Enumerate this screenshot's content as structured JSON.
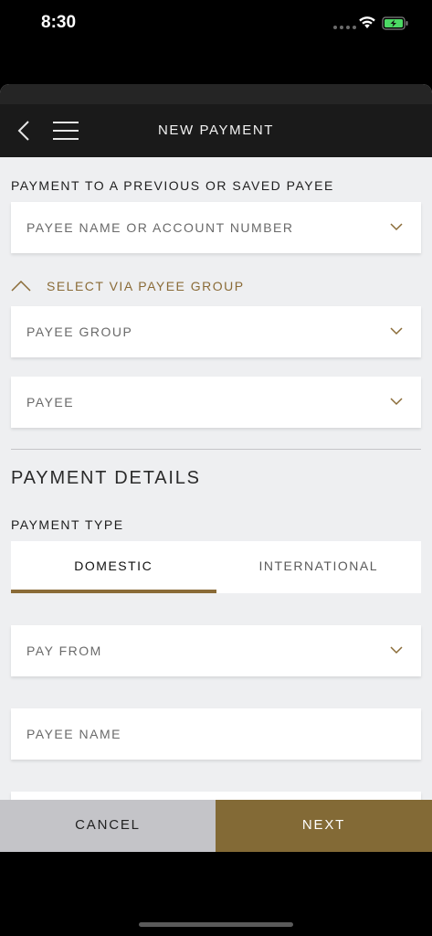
{
  "status_bar": {
    "time": "8:30"
  },
  "header": {
    "title": "NEW PAYMENT"
  },
  "payee_section": {
    "heading": "PAYMENT TO A PREVIOUS OR SAVED PAYEE",
    "payee_select_label": "PAYEE NAME OR ACCOUNT NUMBER",
    "group_toggle_label": "SELECT VIA PAYEE GROUP",
    "payee_group_label": "PAYEE GROUP",
    "payee_label": "PAYEE"
  },
  "details": {
    "title": "PAYMENT DETAILS",
    "payment_type_label": "PAYMENT TYPE",
    "tabs": [
      {
        "label": "DOMESTIC",
        "selected": true
      },
      {
        "label": "INTERNATIONAL",
        "selected": false
      }
    ],
    "pay_from_label": "PAY FROM",
    "payee_name_label": "PAYEE NAME"
  },
  "footer": {
    "cancel_label": "CANCEL",
    "next_label": "NEXT"
  },
  "colors": {
    "accent": "#8a6b37",
    "nav_background": "#1a1a1a",
    "page_background": "#eeeff1"
  }
}
